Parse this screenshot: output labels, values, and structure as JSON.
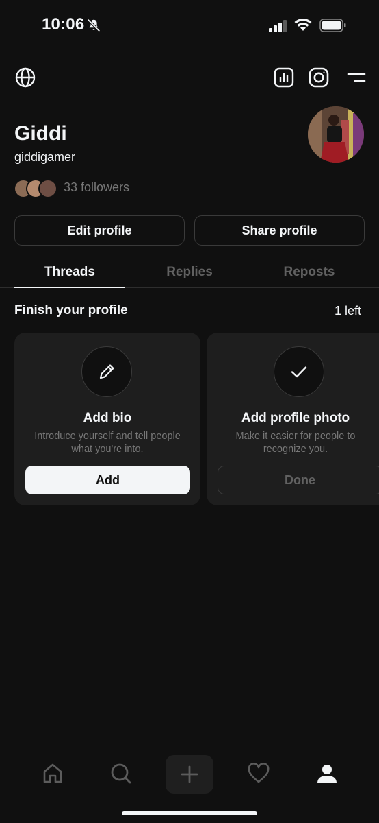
{
  "status_bar": {
    "time": "10:06",
    "icons": [
      "bell-slash-icon",
      "signal-icon",
      "wifi-icon",
      "battery-icon"
    ]
  },
  "top_nav": {
    "icons": [
      "globe-icon",
      "insights-icon",
      "instagram-icon",
      "menu-icon"
    ]
  },
  "profile": {
    "name": "Giddi",
    "handle": "giddigamer",
    "followers": "33 followers"
  },
  "actions": {
    "edit_label": "Edit profile",
    "share_label": "Share profile"
  },
  "tabs": [
    {
      "label": "Threads",
      "active": true
    },
    {
      "label": "Replies",
      "active": false
    },
    {
      "label": "Reposts",
      "active": false
    }
  ],
  "finish": {
    "title": "Finish your profile",
    "remaining": "1 left",
    "cards": [
      {
        "title": "Add bio",
        "description": "Introduce yourself and tell people what you're into.",
        "button": "Add",
        "icon": "pencil-icon"
      },
      {
        "title": "Add profile photo",
        "description": "Make it easier for people to recognize you.",
        "button": "Done",
        "icon": "checkmark-icon"
      }
    ]
  },
  "bottom_nav": {
    "items": [
      "home-icon",
      "search-icon",
      "plus-icon",
      "heart-icon",
      "profile-icon"
    ]
  },
  "colors": {
    "background": "#101010",
    "text": "#f3f5f7",
    "muted": "#777777",
    "card": "#1e1e1e"
  }
}
